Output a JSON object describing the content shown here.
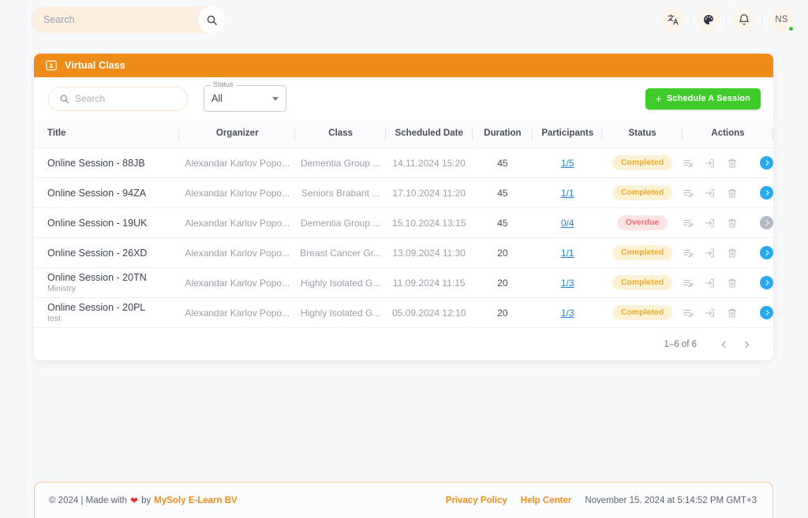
{
  "topbar": {
    "search_placeholder": "Search",
    "search_value": "",
    "icons": [
      {
        "name": "translate-icon",
        "glyph": "translate"
      },
      {
        "name": "palette-icon",
        "glyph": "palette"
      },
      {
        "name": "bell-icon",
        "glyph": "bell"
      }
    ],
    "avatar_initials": "NS",
    "status_color": "#3fc23f"
  },
  "card": {
    "header_title": "Virtual Class",
    "header_color": "#ef8c19",
    "search_placeholder": "Search",
    "search_value": "",
    "status_label": "Status",
    "status_value": "All",
    "schedule_button": "Schedule A Session",
    "schedule_button_color": "#3fcc2a"
  },
  "table": {
    "columns": [
      "Title",
      "Organizer",
      "Class",
      "Scheduled Date",
      "Duration",
      "Participants",
      "Status",
      "Actions"
    ],
    "rows": [
      {
        "title": "Online Session - 88JB",
        "subtitle": "",
        "organizer": "Alexandar Karlov Popo...",
        "class": "Dementia Group ...",
        "date": "14.11.2024 15:20",
        "duration": "45",
        "participants": "1/5",
        "status": "Completed",
        "status_kind": "completed",
        "go_enabled": true
      },
      {
        "title": "Online Session - 94ZA",
        "subtitle": "",
        "organizer": "Alexandar Karlov Popo...",
        "class": "Seniors Brabant ...",
        "date": "17.10.2024 11:20",
        "duration": "45",
        "participants": "1/1",
        "status": "Completed",
        "status_kind": "completed",
        "go_enabled": true
      },
      {
        "title": "Online Session - 19UK",
        "subtitle": "",
        "organizer": "Alexandar Karlov Popo...",
        "class": "Dementia Group ...",
        "date": "15.10.2024 13:15",
        "duration": "45",
        "participants": "0/4",
        "status": "Overdue",
        "status_kind": "overdue",
        "go_enabled": false
      },
      {
        "title": "Online Session - 26XD",
        "subtitle": "",
        "organizer": "Alexandar Karlov Popo...",
        "class": "Breast Cancer Gr...",
        "date": "13.09.2024 11:30",
        "duration": "20",
        "participants": "1/1",
        "status": "Completed",
        "status_kind": "completed",
        "go_enabled": true
      },
      {
        "title": "Online Session - 20TN",
        "subtitle": "Ministry",
        "organizer": "Alexandar Karlov Popo...",
        "class": "Highly Isolated G...",
        "date": "11.09.2024 11:15",
        "duration": "20",
        "participants": "1/3",
        "status": "Completed",
        "status_kind": "completed",
        "go_enabled": true
      },
      {
        "title": "Online Session - 20PL",
        "subtitle": "test",
        "organizer": "Alexandar Karlov Popo...",
        "class": "Highly Isolated G...",
        "date": "05.09.2024 12:10",
        "duration": "20",
        "participants": "1/3",
        "status": "Completed",
        "status_kind": "completed",
        "go_enabled": true
      }
    ],
    "action_icons": [
      "edit-note-icon",
      "join-session-icon",
      "delete-icon",
      "open-detail-icon"
    ]
  },
  "pagination": {
    "range": "1–6 of 6",
    "prev": "previous-page",
    "next": "next-page"
  },
  "footer": {
    "copyright": "© 2024 | Made with",
    "by": "by",
    "brand": "MySoly E-Learn BV",
    "privacy": "Privacy Policy",
    "help": "Help Center",
    "timestamp": "November 15, 2024 at 5:14:52 PM GMT+3"
  }
}
